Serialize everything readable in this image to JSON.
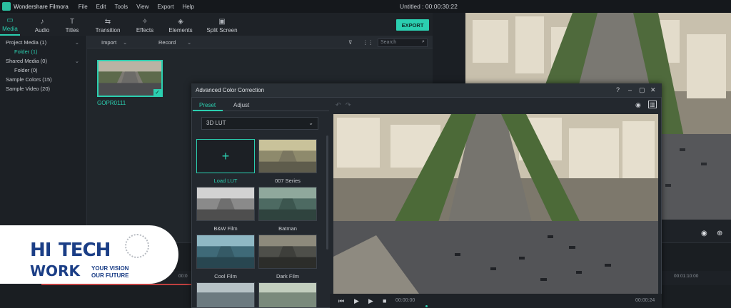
{
  "titlebar": {
    "app_name": "Wondershare Filmora",
    "menu": [
      "File",
      "Edit",
      "Tools",
      "View",
      "Export",
      "Help"
    ],
    "project": "Untitled : 00:00:30:22"
  },
  "tabs": [
    {
      "label": "Media",
      "icon": "folder-icon",
      "active": true
    },
    {
      "label": "Audio",
      "icon": "music-note-icon",
      "active": false
    },
    {
      "label": "Titles",
      "icon": "text-icon",
      "active": false
    },
    {
      "label": "Transition",
      "icon": "transition-icon",
      "active": false
    },
    {
      "label": "Effects",
      "icon": "effects-icon",
      "active": false
    },
    {
      "label": "Elements",
      "icon": "elements-icon",
      "active": false
    },
    {
      "label": "Split Screen",
      "icon": "split-screen-icon",
      "active": false
    }
  ],
  "export_label": "EXPORT",
  "library": {
    "items": [
      {
        "label": "Project Media (1)",
        "sub": false,
        "selected": false
      },
      {
        "label": "Folder (1)",
        "sub": true,
        "selected": true
      },
      {
        "label": "Shared Media (0)",
        "sub": false,
        "selected": false
      },
      {
        "label": "Folder (0)",
        "sub": true,
        "selected": false
      },
      {
        "label": "Sample Colors (15)",
        "sub": false,
        "selected": false
      },
      {
        "label": "Sample Video (20)",
        "sub": false,
        "selected": false
      }
    ]
  },
  "media": {
    "import_label": "Import",
    "record_label": "Record",
    "search_placeholder": "Search",
    "clip_name": "GOPR0111"
  },
  "dialog": {
    "title": "Advanced Color Correction",
    "tab_preset": "Preset",
    "tab_adjust": "Adjust",
    "lut_dropdown": "3D LUT",
    "presets": [
      "Load LUT",
      "007 Series",
      "B&W Film",
      "Batman",
      "Cool Film",
      "Dark Film"
    ],
    "time_start": "00:00:00",
    "time_end": "00:00:24"
  },
  "timeline": {
    "ticks": [
      "00:0",
      "00:01:10:00"
    ]
  },
  "watermark": {
    "brand_hi": "HI",
    "brand_tech": "TECH",
    "brand_work": "WORK",
    "tagline_1": "YOUR VISION",
    "tagline_2": "OUR FUTURE"
  },
  "colors": {
    "accent": "#2bcfb0",
    "panel": "#1c2025",
    "brand_blue": "#1b3e86"
  }
}
